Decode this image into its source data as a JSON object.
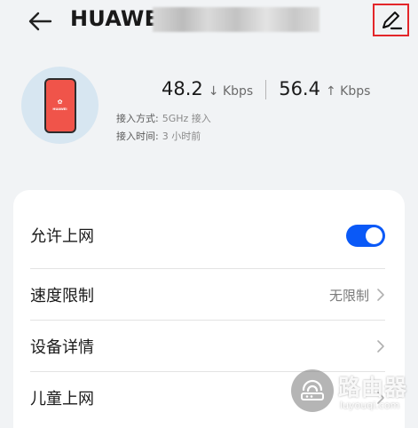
{
  "header": {
    "title": "HUAWEI"
  },
  "device": {
    "phone_logo": "✿",
    "phone_brand": "HUAWEI",
    "download_speed": "48.2",
    "download_unit": "↓ Kbps",
    "upload_speed": "56.4",
    "upload_unit": "↑ Kbps",
    "access_mode_label": "接入方式:",
    "access_mode_value": "5GHz 接入",
    "access_time_label": "接入时间:",
    "access_time_value": "3 小时前"
  },
  "settings": {
    "allow_internet": {
      "label": "允许上网",
      "enabled": true
    },
    "speed_limit": {
      "label": "速度限制",
      "value": "无限制"
    },
    "device_details": {
      "label": "设备详情"
    },
    "child_internet": {
      "label": "儿童上网"
    }
  },
  "watermark": {
    "text": "路由器",
    "sub": "luyouqi.com"
  },
  "colors": {
    "accent": "#0a59f7",
    "highlight_border": "#e3262a",
    "background": "#f1f3f5"
  }
}
